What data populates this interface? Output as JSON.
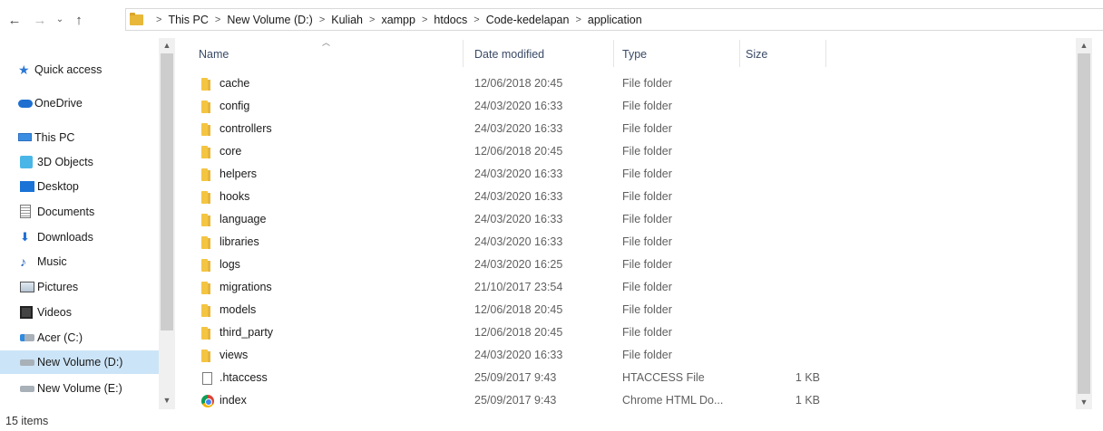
{
  "address": {
    "crumbs": [
      "This PC",
      "New Volume (D:)",
      "Kuliah",
      "xampp",
      "htdocs",
      "Code-kedelapan",
      "application"
    ]
  },
  "nav": {
    "items": [
      {
        "label": "Quick access",
        "icon": "star-icon"
      },
      {
        "label": "OneDrive",
        "icon": "cloud-icon"
      },
      {
        "label": "This PC",
        "icon": "computer-icon"
      },
      {
        "label": "3D Objects",
        "icon": "cube-icon"
      },
      {
        "label": "Desktop",
        "icon": "desktop-icon"
      },
      {
        "label": "Documents",
        "icon": "document-icon"
      },
      {
        "label": "Downloads",
        "icon": "download-arrow-icon"
      },
      {
        "label": "Music",
        "icon": "music-note-icon"
      },
      {
        "label": "Pictures",
        "icon": "pictures-icon"
      },
      {
        "label": "Videos",
        "icon": "film-icon"
      },
      {
        "label": "Acer (C:)",
        "icon": "windows-drive-icon"
      },
      {
        "label": "New Volume (D:)",
        "icon": "drive-icon",
        "selected": true
      },
      {
        "label": "New Volume (E:)",
        "icon": "drive-icon"
      }
    ]
  },
  "columns": {
    "name": "Name",
    "date": "Date modified",
    "type": "Type",
    "size": "Size"
  },
  "files": [
    {
      "name": "cache",
      "date": "12/06/2018 20:45",
      "type": "File folder",
      "size": "",
      "icon": "folder-icon"
    },
    {
      "name": "config",
      "date": "24/03/2020 16:33",
      "type": "File folder",
      "size": "",
      "icon": "folder-icon"
    },
    {
      "name": "controllers",
      "date": "24/03/2020 16:33",
      "type": "File folder",
      "size": "",
      "icon": "folder-icon"
    },
    {
      "name": "core",
      "date": "12/06/2018 20:45",
      "type": "File folder",
      "size": "",
      "icon": "folder-icon"
    },
    {
      "name": "helpers",
      "date": "24/03/2020 16:33",
      "type": "File folder",
      "size": "",
      "icon": "folder-icon"
    },
    {
      "name": "hooks",
      "date": "24/03/2020 16:33",
      "type": "File folder",
      "size": "",
      "icon": "folder-icon"
    },
    {
      "name": "language",
      "date": "24/03/2020 16:33",
      "type": "File folder",
      "size": "",
      "icon": "folder-icon"
    },
    {
      "name": "libraries",
      "date": "24/03/2020 16:33",
      "type": "File folder",
      "size": "",
      "icon": "folder-icon"
    },
    {
      "name": "logs",
      "date": "24/03/2020 16:25",
      "type": "File folder",
      "size": "",
      "icon": "folder-icon"
    },
    {
      "name": "migrations",
      "date": "21/10/2017 23:54",
      "type": "File folder",
      "size": "",
      "icon": "folder-icon"
    },
    {
      "name": "models",
      "date": "12/06/2018 20:45",
      "type": "File folder",
      "size": "",
      "icon": "folder-icon"
    },
    {
      "name": "third_party",
      "date": "12/06/2018 20:45",
      "type": "File folder",
      "size": "",
      "icon": "folder-icon"
    },
    {
      "name": "views",
      "date": "24/03/2020 16:33",
      "type": "File folder",
      "size": "",
      "icon": "folder-icon"
    },
    {
      "name": ".htaccess",
      "date": "25/09/2017 9:43",
      "type": "HTACCESS File",
      "size": "1 KB",
      "icon": "file-icon"
    },
    {
      "name": "index",
      "date": "25/09/2017 9:43",
      "type": "Chrome HTML Do...",
      "size": "1 KB",
      "icon": "chrome-icon"
    }
  ],
  "status": {
    "count": "15 items"
  }
}
